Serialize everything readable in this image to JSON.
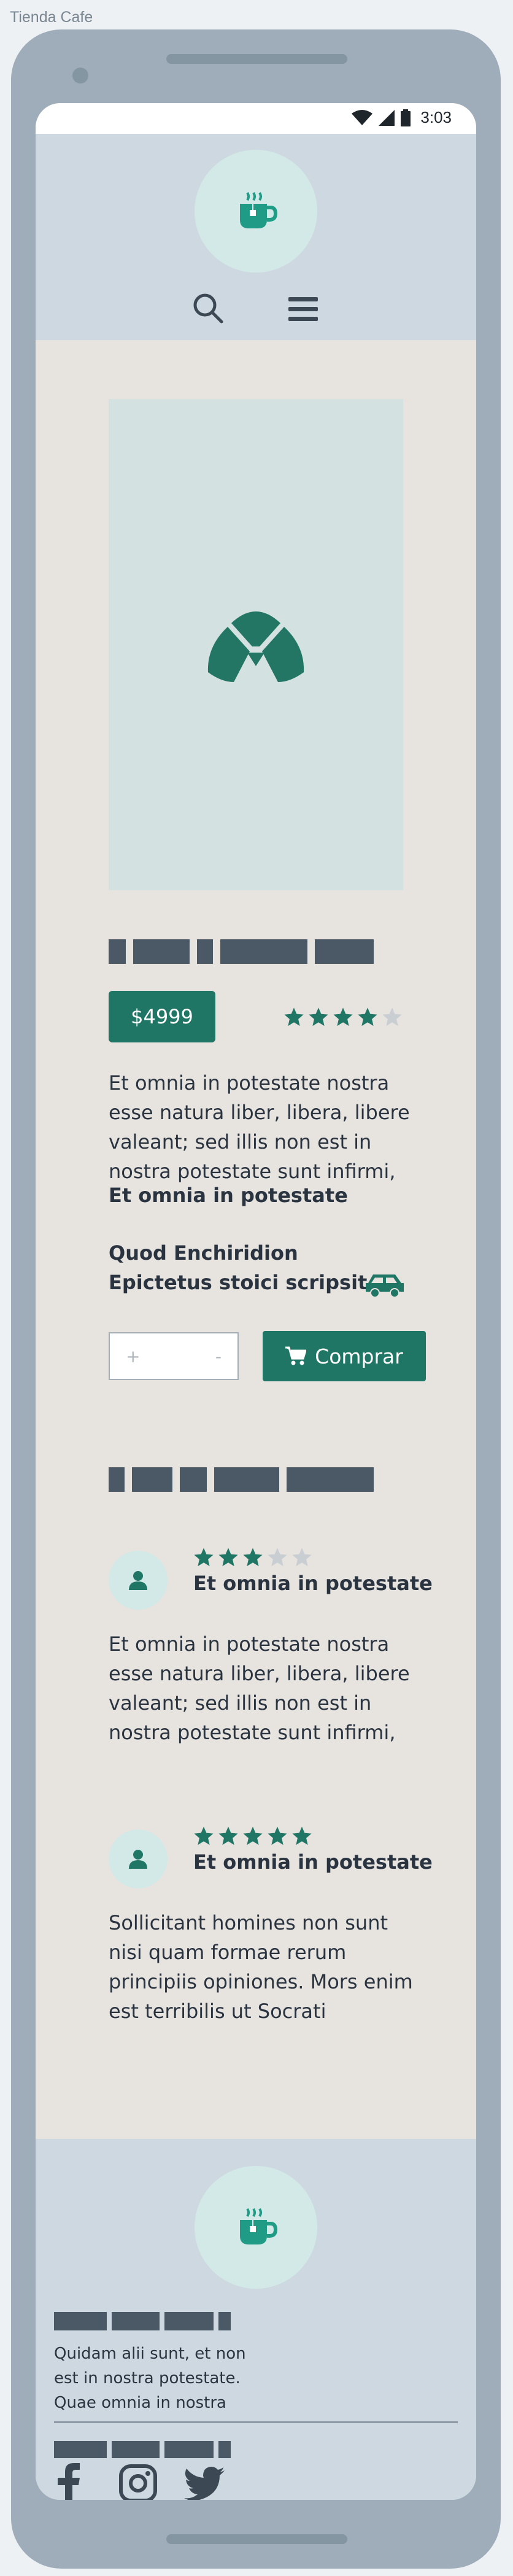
{
  "window": {
    "title": "Tienda Cafe"
  },
  "status_bar": {
    "time": "3:03",
    "icons": [
      "wifi-icon",
      "signal-icon",
      "battery-icon"
    ]
  },
  "header": {
    "logo_icon": "coffee-cup-icon",
    "nav_icons": [
      "search-icon",
      "hamburger-menu-icon"
    ]
  },
  "product": {
    "image_icon": "croissant-icon",
    "price": "$4999",
    "rating": 4,
    "rating_max": 5,
    "description": "Et omnia in potestate nostra esse natura liber, libera, libere valeant; sed illis non est in nostra potestate sunt infirmi,",
    "subtitle": "Et omnia in potestate",
    "shipping_line_1": "Quod Enchiridion",
    "shipping_line_2": "Epictetus stoici scripsit.",
    "shipping_icon": "car-icon",
    "quantity": {
      "plus": "+",
      "minus": "-"
    },
    "buy_label": "Comprar",
    "buy_icon": "cart-icon"
  },
  "reviews": [
    {
      "avatar_icon": "user-icon",
      "rating": 3,
      "rating_max": 5,
      "title": "Et omnia in potestate",
      "text": "Et omnia in potestate nostra esse natura liber, libera, libere valeant; sed illis non est in nostra potestate sunt infirmi,"
    },
    {
      "avatar_icon": "user-icon",
      "rating": 5,
      "rating_max": 5,
      "title": "Et omnia in potestate",
      "text": "Sollicitant homines non sunt nisi quam formae rerum principiis opiniones. Mors enim est terribilis ut Socrati"
    }
  ],
  "footer": {
    "logo_icon": "coffee-cup-icon",
    "text": "Quidam alii sunt, et non est in nostra potestate. Quae omnia in nostra",
    "social_icons": [
      "facebook-icon",
      "instagram-icon",
      "twitter-icon"
    ]
  },
  "colors": {
    "accent": "#1f7665",
    "star_empty": "#c9ced2",
    "header_bg": "#ced8e0",
    "content_bg": "#e7e3df",
    "placeholder": "#4b5967"
  }
}
